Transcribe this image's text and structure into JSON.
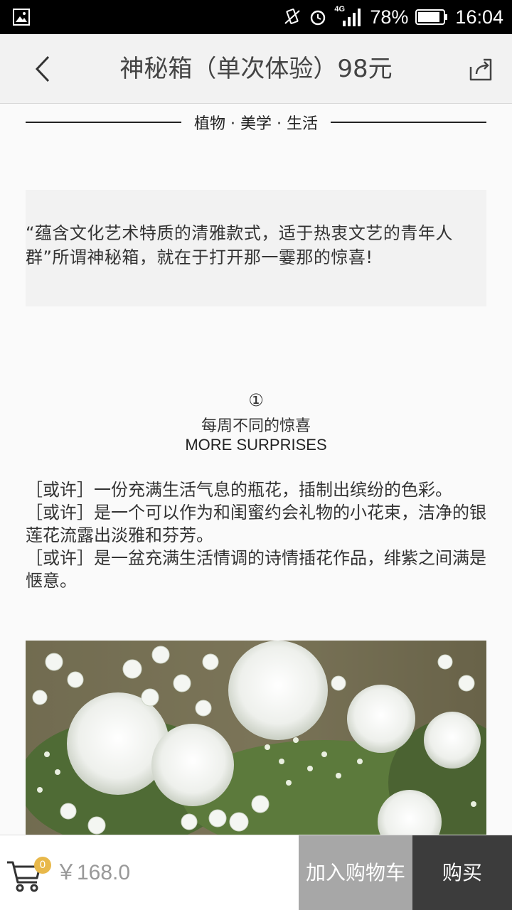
{
  "status_bar": {
    "battery": "78%",
    "time": "16:04",
    "network": "4G",
    "icons": [
      "image-icon",
      "vibrate-icon",
      "alarm-icon",
      "signal-icon",
      "battery-icon"
    ]
  },
  "nav": {
    "title": "神秘箱（单次体验）98元",
    "back_icon": "chevron-left-icon",
    "share_icon": "share-icon"
  },
  "header_tagline": "植物 · 美学 · 生活",
  "quote": "“蕴含文化艺术特质的清雅款式，适于热衷文艺的青年人群”所谓神秘箱，就在于打开那一霎那的惊喜!",
  "section": {
    "number": "①",
    "title_cn": "每周不同的惊喜",
    "title_en": "MORE SURPRISES"
  },
  "descriptions": [
    "［或许］一份充满生活气息的瓶花，插制出缤纷的色彩。",
    "［或许］是一个可以作为和闺蜜约会礼物的小花束，洁净的银莲花流露出淡雅和芬芳。",
    "［或许］是一盆充满生活情调的诗情插花作品，绯紫之间满是惬意。"
  ],
  "bottom_bar": {
    "cart_count": "0",
    "price": "￥168.0",
    "add_to_cart": "加入购物车",
    "buy": "购买"
  },
  "colors": {
    "status_bar": "#000000",
    "nav_bg": "#f2f2f2",
    "add_cart_bg": "#a7a7a7",
    "buy_bg": "#3c3c3c",
    "badge": "#e8b84a"
  }
}
